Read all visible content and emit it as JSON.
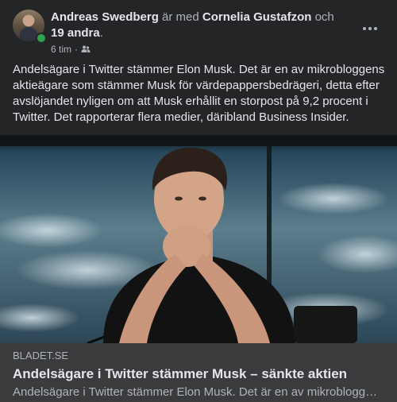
{
  "post": {
    "author": "Andreas Swedberg",
    "with_text": " är med ",
    "tagged": "Cornelia Gustafzon",
    "and_text": " och ",
    "others": "19 andra",
    "period": ".",
    "time": "6 tim",
    "dot": "·",
    "audience_icon": "friends-icon",
    "more_icon": "more-horizontal-icon",
    "text": "Andelsägare i Twitter stämmer Elon Musk. Det är en av mikrobloggens aktieägare som stämmer Musk för värdepappersbedrägeri, detta efter avslöjandet nyligen om att Musk erhållit en storpost på 9,2 procent i Twitter. Det rapporterar flera medier, däribland Business Insider."
  },
  "link_preview": {
    "domain": "BLADET.SE",
    "title": "Andelsägare i Twitter stämmer Musk – sänkte aktien",
    "description": "Andelsägare i Twitter stämmer Elon Musk. Det är en av mikrobloggens aktieägare som stämmer Musk för värdepappersbedrägeri"
  },
  "colors": {
    "background": "#242526",
    "link_box": "#3a3b3c",
    "online": "#31a24c",
    "text_primary": "#e4e6eb",
    "text_secondary": "#b0b3b8"
  }
}
